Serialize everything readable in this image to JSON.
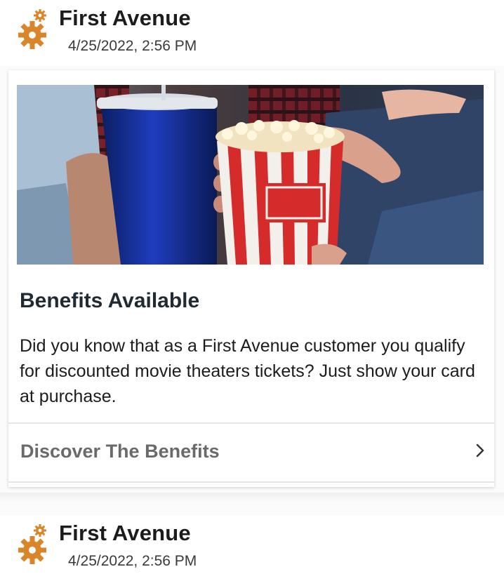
{
  "messages": [
    {
      "sender": "First Avenue",
      "timestamp": "4/25/2022, 2:56 PM"
    },
    {
      "sender": "First Avenue",
      "timestamp": "4/25/2022, 2:56 PM"
    }
  ],
  "card": {
    "title": "Benefits Available",
    "body": "Did you know that as a First Avenue customer you qualify for discounted movie theaters tickets? Just show your card at purchase.",
    "cta_label": "Discover The Benefits",
    "chevron_icon": "chevron-right-icon"
  },
  "colors": {
    "logo_orange": "#d9862a",
    "cta_text": "#6a6a6a"
  },
  "icons": [
    "gears-logo-icon",
    "chevron-right-icon"
  ]
}
